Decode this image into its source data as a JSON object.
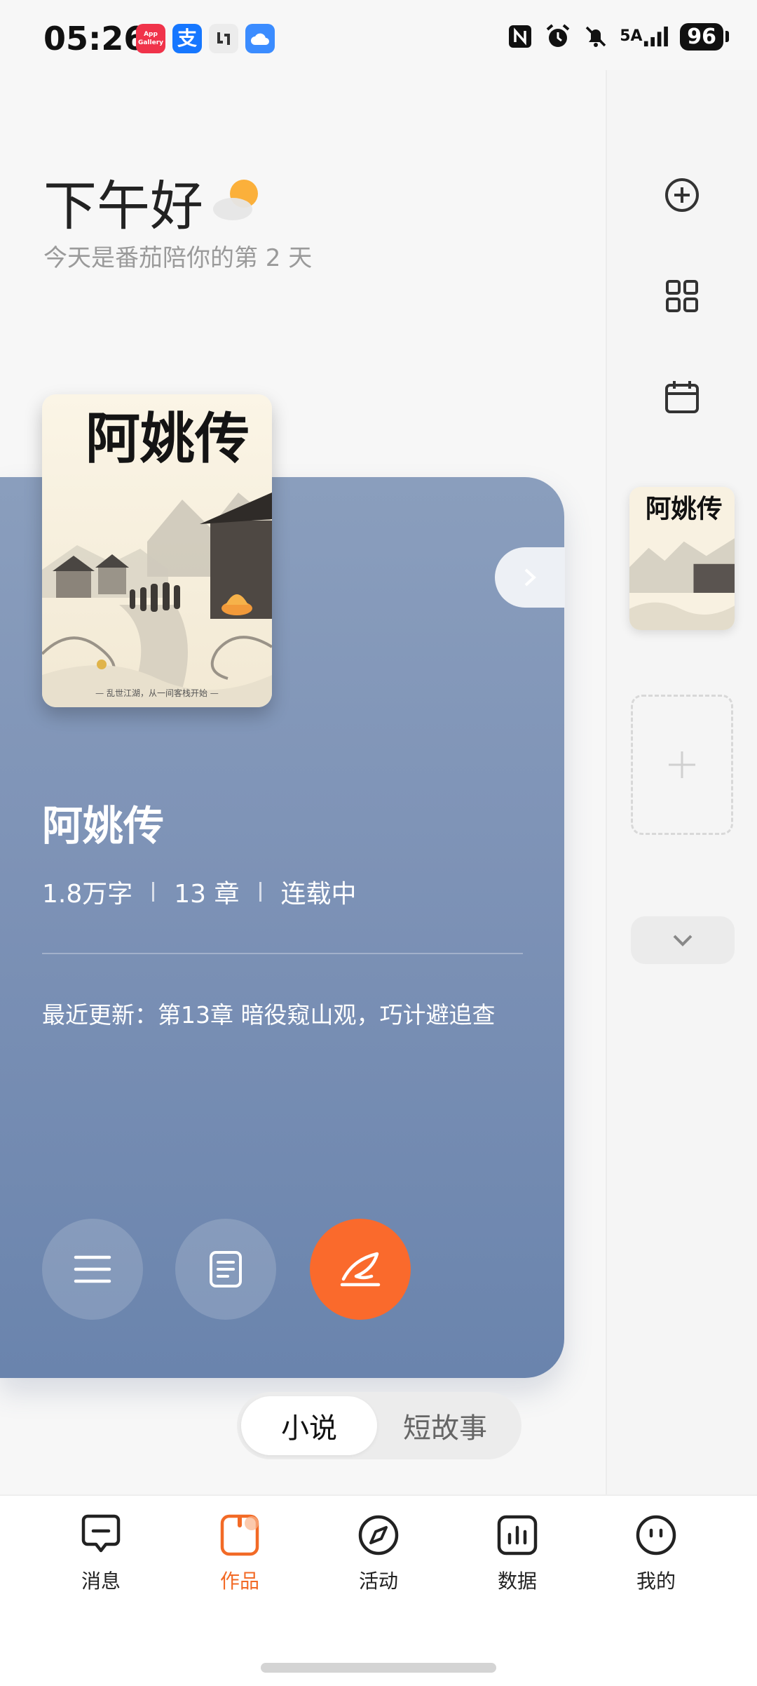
{
  "status_bar": {
    "time": "05:26",
    "app_icons": [
      {
        "name": "app-gallery-icon",
        "label": "App Gallery",
        "color": "#f0334a"
      },
      {
        "name": "alipay-icon",
        "label": "支",
        "color": "#1677ff"
      },
      {
        "name": "clip-app-icon",
        "label": "",
        "color": "#e8e8e8"
      },
      {
        "name": "cloud-app-icon",
        "label": "",
        "color": "#3b8cff"
      }
    ],
    "network": "5A",
    "battery": "96"
  },
  "greeting": {
    "title": "下午好",
    "subtitle": "今天是番茄陪你的第 2 天"
  },
  "book": {
    "cover_title": "阿姚传",
    "cover_tagline": "— 乱世江湖，从一间客栈开始 —",
    "title": "阿姚传",
    "word_count": "1.8万字",
    "chapters": "13 章",
    "status": "连载中",
    "latest_update": "最近更新：第13章 暗役窥山观，巧计避追查"
  },
  "type_switch": {
    "tabs": [
      {
        "label": "小说",
        "active": true
      },
      {
        "label": "短故事",
        "active": false
      }
    ]
  },
  "bottom_nav": {
    "items": [
      {
        "label": "消息",
        "icon": "message-icon",
        "active": false
      },
      {
        "label": "作品",
        "icon": "works-icon",
        "active": true
      },
      {
        "label": "活动",
        "icon": "compass-icon",
        "active": false
      },
      {
        "label": "数据",
        "icon": "stats-icon",
        "active": false
      },
      {
        "label": "我的",
        "icon": "profile-face-icon",
        "active": false
      }
    ]
  },
  "colors": {
    "accent": "#fa6a2c",
    "card": "#7d92b6",
    "background": "#f7f7f7"
  }
}
